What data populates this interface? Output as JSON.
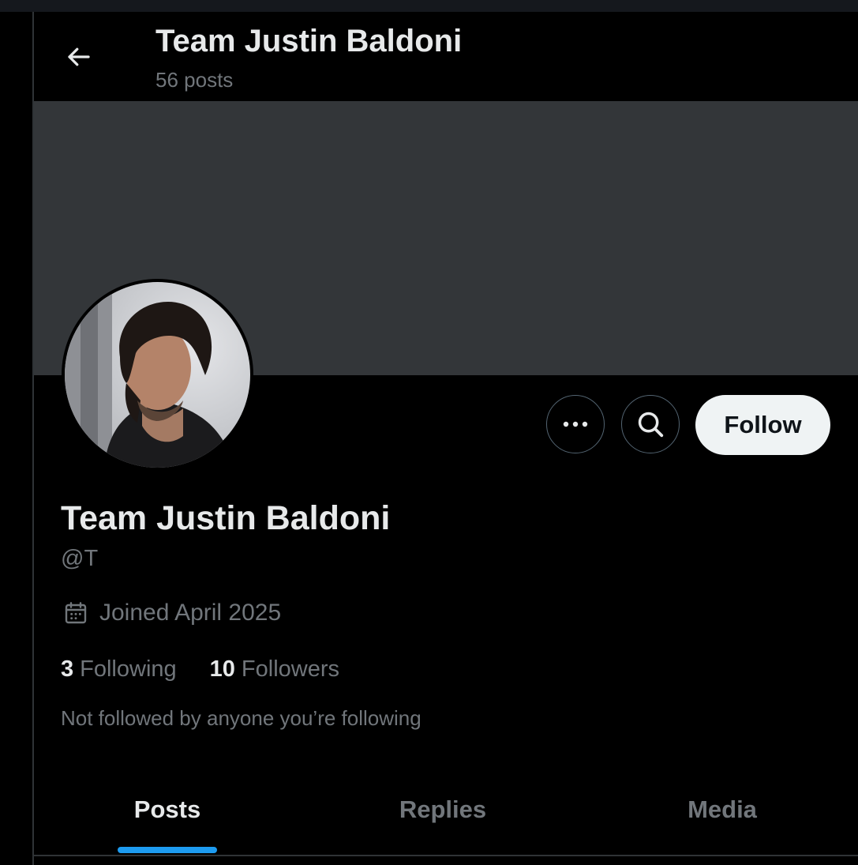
{
  "header": {
    "title": "Team Justin Baldoni",
    "post_count": "56 posts"
  },
  "profile": {
    "display_name": "Team Justin Baldoni",
    "handle": "@T",
    "joined": "Joined April 2025",
    "following_count": "3",
    "following_label": "Following",
    "followers_count": "10",
    "followers_label": "Followers",
    "followed_by_note": "Not followed by anyone you’re following"
  },
  "actions": {
    "follow_label": "Follow"
  },
  "tabs": [
    {
      "label": "Posts",
      "active": true
    },
    {
      "label": "Replies",
      "active": false
    },
    {
      "label": "Media",
      "active": false
    }
  ],
  "icons": {
    "back": "arrow-left-icon",
    "more": "more-horizontal-icon",
    "search": "search-icon",
    "calendar": "calendar-icon"
  },
  "colors": {
    "background": "#000000",
    "banner": "#333639",
    "primary_text": "#e7e9ea",
    "secondary_text": "#71767b",
    "accent": "#1d9bf0",
    "follow_button_bg": "#eff3f4",
    "border": "#2f3336"
  }
}
